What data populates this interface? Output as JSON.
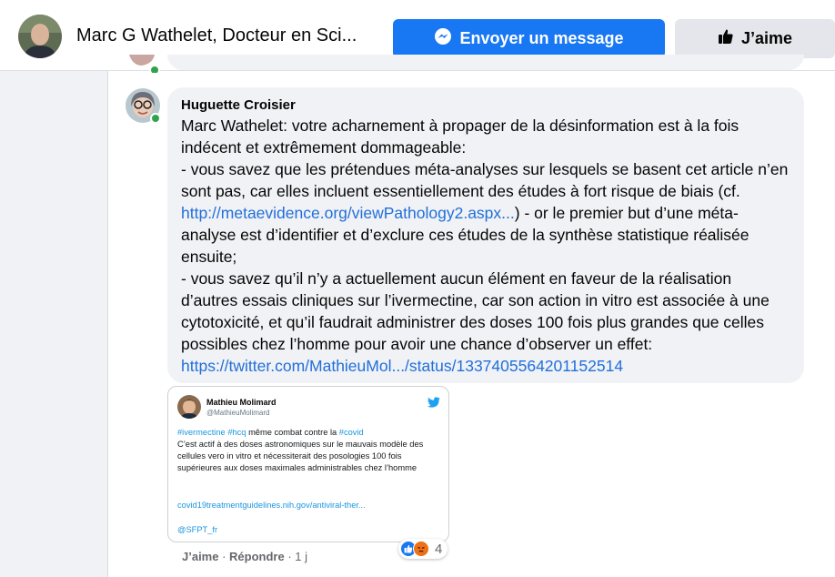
{
  "header": {
    "page_name": "Marc G Wathelet, Docteur en Sci...",
    "message_button_label": "Envoyer un message",
    "like_button_label": "J’aime"
  },
  "comment": {
    "author": "Huguette Croisier",
    "text_part1": "Marc Wathelet: votre acharnement à propager de la désinformation est à la fois indécent et extrêmement dommageable:\n- vous savez que les prétendues méta-analyses sur lesquels se basent cet article n’en sont pas, car elles incluent essentiellement des études à fort risque de biais (cf. ",
    "link1": "http://metaevidence.org/viewPathology2.aspx...",
    "text_part2": ") - or le premier but d’une méta-analyse est d’identifier et d’exclure ces études de la synthèse statistique réalisée ensuite;\n- vous savez qu’il n’y a actuellement aucun élément en faveur de la réalisation d’autres essais cliniques sur l’ivermectine, car son action in vitro est associée à une cytotoxicité, et qu’il faudrait administrer des doses 100 fois plus grandes que celles possibles chez l’homme pour avoir une chance d’observer un effet:\n",
    "link2": "https://twitter.com/MathieuMol.../status/1337405564201152514"
  },
  "tweet": {
    "name": "Mathieu Molimard",
    "handle": "@MathieuMolimard",
    "hashtag1": "#ivermectine",
    "hashtag2": "#hcq",
    "text_middle": " même combat contre la ",
    "hashtag3": "#covid",
    "body": "C’est actif à des doses astronomiques sur le mauvais modèle des cellules vero in vitro et nécessiterait des posologies 100 fois supérieures aux doses maximales administrables chez l’homme",
    "link": "covid19treatmentguidelines.nih.gov/antiviral-ther...",
    "mention": "@SFPT_fr"
  },
  "actions": {
    "like": "J’aime",
    "separator": " · ",
    "reply": "Répondre",
    "time": "1 j"
  },
  "reactions": {
    "icons": [
      "like-icon",
      "angry-icon"
    ],
    "count": "4"
  },
  "colors": {
    "accent": "#1877f2",
    "link": "#216fdb",
    "online": "#31a24c",
    "twitter": "#1b95e0"
  }
}
